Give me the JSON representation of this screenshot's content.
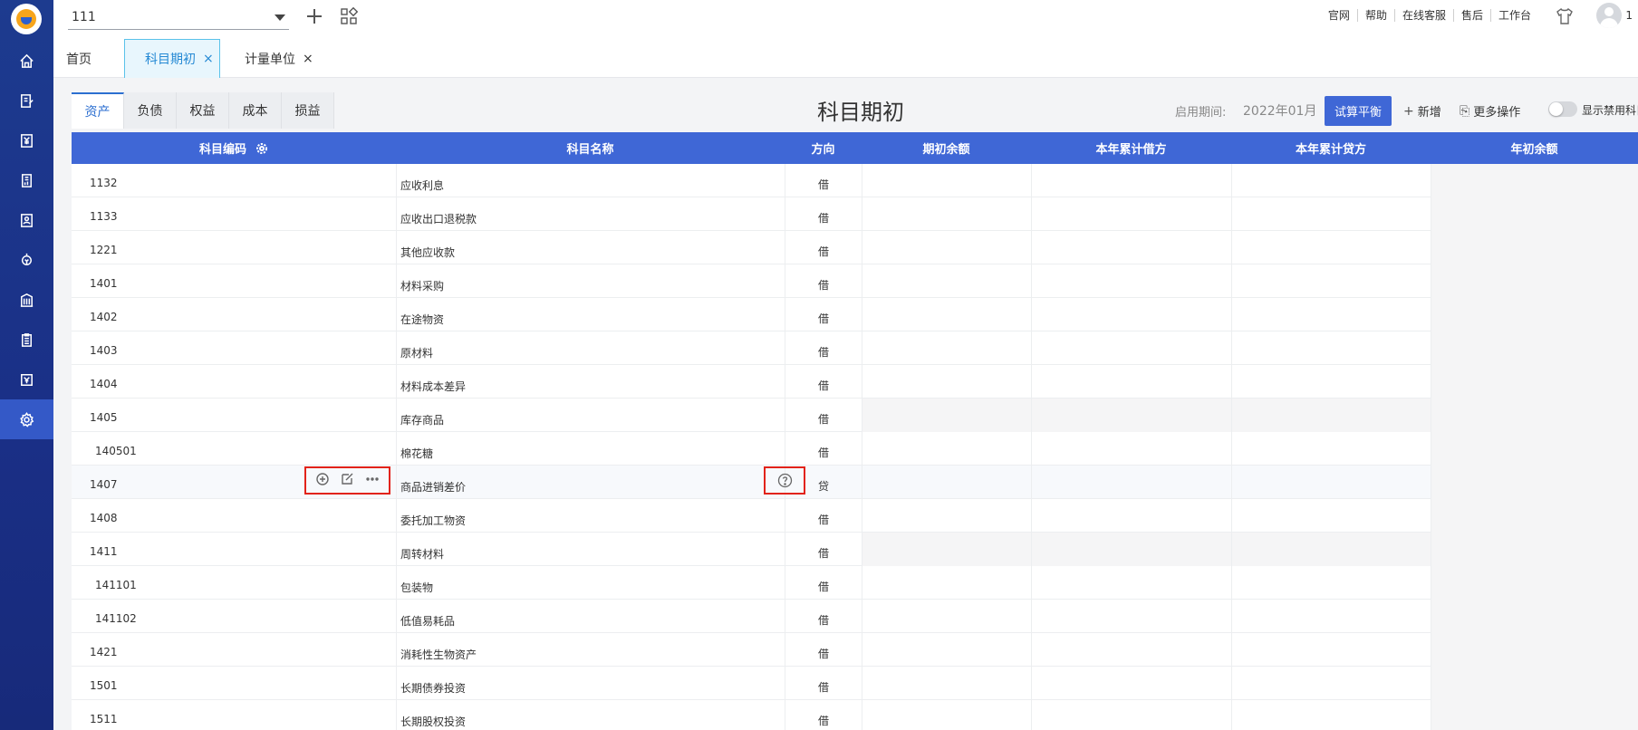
{
  "topbar": {
    "org_value": "111",
    "links": [
      "官网",
      "帮助",
      "在线客服",
      "售后",
      "工作台"
    ],
    "user_initial": "1"
  },
  "page_tabs": [
    {
      "label": "首页",
      "closable": false,
      "active": false
    },
    {
      "label": "科目期初",
      "closable": true,
      "active": true
    },
    {
      "label": "计量单位",
      "closable": true,
      "active": false
    }
  ],
  "close_glyph": "×",
  "sub_tabs": [
    "资产",
    "负债",
    "权益",
    "成本",
    "损益"
  ],
  "header": {
    "title": "科目期初",
    "period_label": "启用期间:",
    "period_value": "2022年01月",
    "trial_balance_label": "试算平衡",
    "add_label": "新增",
    "more_label": "更多操作",
    "show_disabled_label": "显示禁用科目"
  },
  "table": {
    "columns": [
      "科目编码",
      "科目名称",
      "方向",
      "期初余额",
      "本年累计借方",
      "本年累计贷方",
      "年初余额"
    ],
    "rows": [
      {
        "code": "1132",
        "name": "应收利息",
        "dir": "借",
        "indent": false
      },
      {
        "code": "1133",
        "name": "应收出口退税款",
        "dir": "借",
        "indent": false
      },
      {
        "code": "1221",
        "name": "其他应收款",
        "dir": "借",
        "indent": false
      },
      {
        "code": "1401",
        "name": "材料采购",
        "dir": "借",
        "indent": false
      },
      {
        "code": "1402",
        "name": "在途物资",
        "dir": "借",
        "indent": false
      },
      {
        "code": "1403",
        "name": "原材料",
        "dir": "借",
        "indent": false
      },
      {
        "code": "1404",
        "name": "材料成本差异",
        "dir": "借",
        "indent": false
      },
      {
        "code": "1405",
        "name": "库存商品",
        "dir": "借",
        "indent": false
      },
      {
        "code": "140501",
        "name": "棉花糖",
        "dir": "借",
        "indent": true
      },
      {
        "code": "1407",
        "name": "商品进销差价",
        "dir": "贷",
        "indent": false
      },
      {
        "code": "1408",
        "name": "委托加工物资",
        "dir": "借",
        "indent": false
      },
      {
        "code": "1411",
        "name": "周转材料",
        "dir": "借",
        "indent": false
      },
      {
        "code": "141101",
        "name": "包装物",
        "dir": "借",
        "indent": true
      },
      {
        "code": "141102",
        "name": "低值易耗品",
        "dir": "借",
        "indent": true
      },
      {
        "code": "1421",
        "name": "消耗性生物资产",
        "dir": "借",
        "indent": false
      },
      {
        "code": "1501",
        "name": "长期债券投资",
        "dir": "借",
        "indent": false
      },
      {
        "code": "1511",
        "name": "长期股权投资",
        "dir": "借",
        "indent": false
      }
    ]
  }
}
